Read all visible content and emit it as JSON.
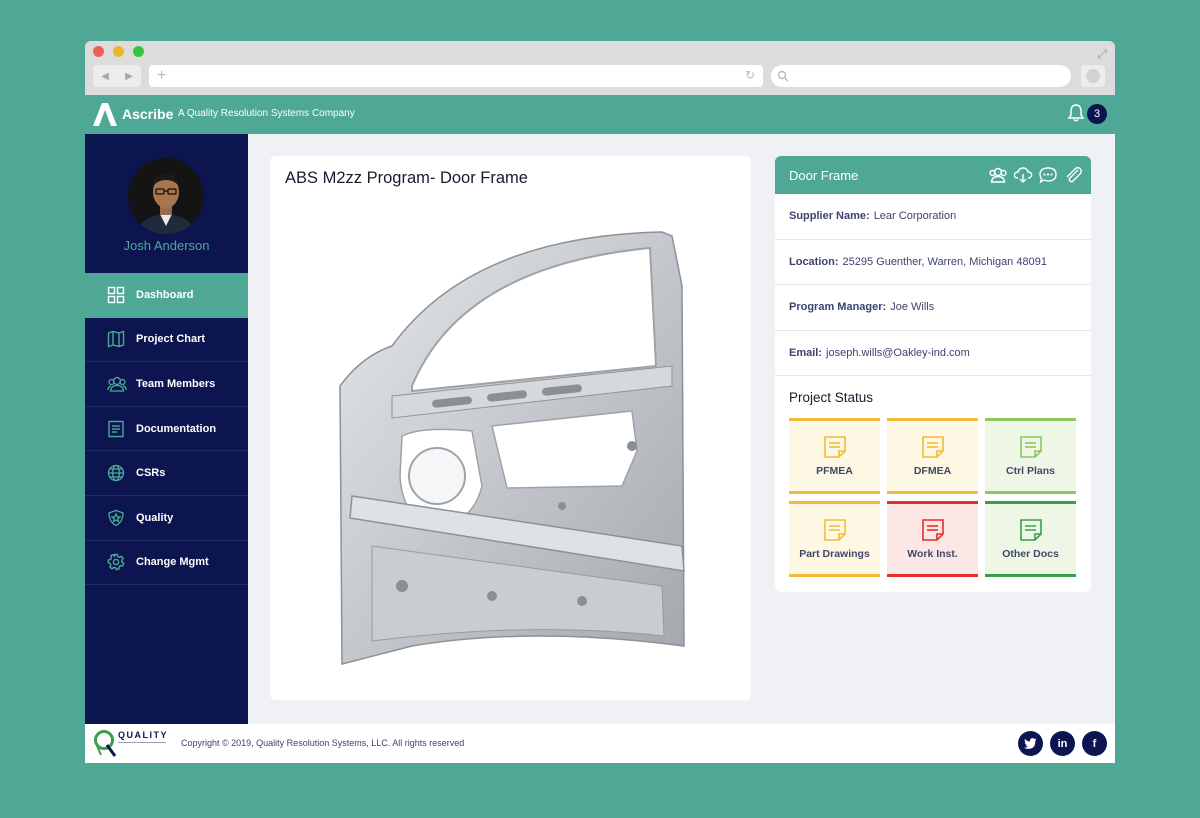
{
  "app": {
    "brand": "Ascribe",
    "tagline": "A Quality Resolution Systems Company",
    "notification_count": "3"
  },
  "user": {
    "name": "Josh Anderson"
  },
  "sidebar": {
    "items": [
      {
        "label": "Dashboard",
        "icon": "dashboard-icon"
      },
      {
        "label": "Project Chart",
        "icon": "map-icon"
      },
      {
        "label": "Team Members",
        "icon": "team-icon"
      },
      {
        "label": "Documentation",
        "icon": "document-icon"
      },
      {
        "label": "CSRs",
        "icon": "globe-icon"
      },
      {
        "label": "Quality",
        "icon": "shield-star-icon"
      },
      {
        "label": "Change Mgmt",
        "icon": "gear-icon"
      }
    ]
  },
  "main": {
    "title": "ABS M2zz Program- Door Frame"
  },
  "panel": {
    "title": "Door Frame",
    "supplier_label": "Supplier Name:",
    "supplier_value": "Lear Corporation",
    "location_label": "Location:",
    "location_value": "25295 Guenther, Warren, Michigan 48091",
    "manager_label": "Program Manager:",
    "manager_value": "Joe Wills",
    "email_label": "Email:",
    "email_value": "joseph.wills@Oakley-ind.com",
    "status_title": "Project Status",
    "tiles": [
      {
        "label": "PFMEA",
        "color": "#f3bb37"
      },
      {
        "label": "DFMEA",
        "color": "#f3bb37"
      },
      {
        "label": "Ctrl Plans",
        "color": "#8cc760"
      },
      {
        "label": "Part Drawings",
        "color": "#f3bb37"
      },
      {
        "label": "Work Inst.",
        "color": "#e52f2a"
      },
      {
        "label": "Other Docs",
        "color": "#3d9d4a"
      }
    ]
  },
  "footer": {
    "logo_text": "QUALITY",
    "copyright": "Copyright © 2019, Quality Resolution Systems, LLC. All rights reserved",
    "social": {
      "linkedin": "in",
      "facebook": "f"
    }
  }
}
